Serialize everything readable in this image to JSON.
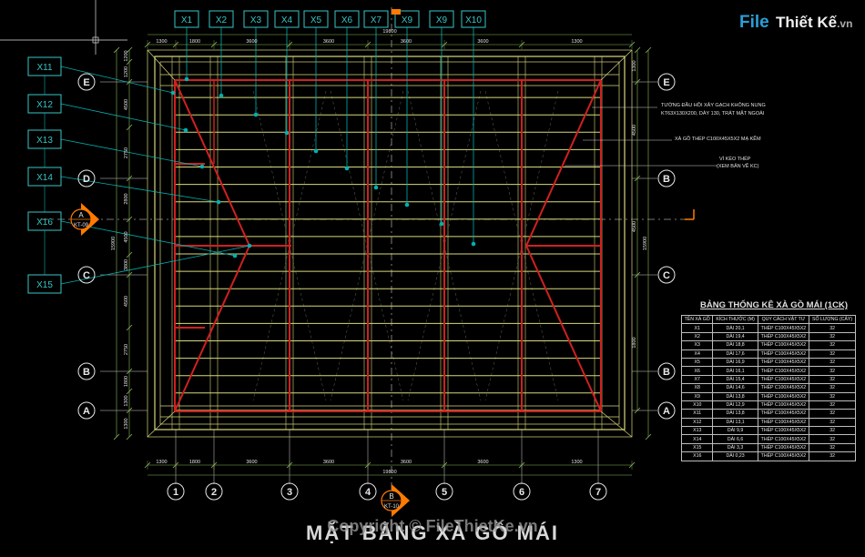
{
  "drawing_title": "MẶT BẰNG XÀ GỒ MÁI",
  "watermark": {
    "brand_blue": "File",
    "brand_rest": "Thiết Kế",
    "brand_tld": ".vn",
    "copyright": "Copyright © FileThietKe.vn"
  },
  "purlin_tags_top": [
    "X1",
    "X2",
    "X3",
    "X4",
    "X5",
    "X6",
    "X7",
    "X9",
    "X9",
    "X10"
  ],
  "purlin_tags_left": [
    "X11",
    "X12",
    "X13",
    "X14",
    "X16",
    "X15"
  ],
  "grid_numbers": [
    "1",
    "2",
    "3",
    "4",
    "5",
    "6",
    "7"
  ],
  "grid_letters_left": [
    "E",
    "D",
    "C",
    "B",
    "A"
  ],
  "grid_letters_right": [
    "E",
    "B",
    "C",
    "B",
    "A"
  ],
  "dimensions": {
    "top_segments": [
      "1300",
      "1800",
      "3600",
      "3600",
      "3600",
      "3600",
      "1300"
    ],
    "top_total": "19800",
    "bottom_segments": [
      "1300",
      "1800",
      "3600",
      "3600",
      "3600",
      "3600",
      "1300"
    ],
    "bottom_total": "19800",
    "left_segments": [
      "1200",
      "1200",
      "4500",
      "2750",
      "2800",
      "4500",
      "3800",
      "4500",
      "2750",
      "1800",
      "1300",
      "1300"
    ],
    "left_total": "15900",
    "right_segments": [
      "1300",
      "4500",
      "4500",
      "1800"
    ],
    "right_total": "15900"
  },
  "section_markers": [
    {
      "letter": "A",
      "sheet": "KT-09"
    },
    {
      "letter": "B",
      "sheet": "KT-10"
    }
  ],
  "notes": [
    "TƯỜNG ĐẦU HỒI XÂY GẠCH KHÔNG NUNG",
    "KT63X130X200, DÀY 130, TRÁT MẶT NGOÀI",
    "XÀ GỒ THÉP C100X45X5X2 MẠ KẼM",
    "VÌ KÈO THÉP",
    "(XEM BẢN VẼ KC)"
  ],
  "table": {
    "title": "BẢNG THỐNG KÊ XÀ GỒ MÁI (1CK)",
    "headers": [
      "TÊN XÀ GỒ",
      "KÍCH THƯỚC (M)",
      "QUY CÁCH VẬT TƯ",
      "SỐ LƯỢNG (CÂY)"
    ],
    "rows": [
      [
        "X1",
        "DÀI 20,1",
        "THÉP C100X45X5X2",
        "32"
      ],
      [
        "X2",
        "DÀI 19,4",
        "THÉP C100X45X5X2",
        "32"
      ],
      [
        "X3",
        "DÀI 18,8",
        "THÉP C100X45X5X2",
        "32"
      ],
      [
        "X4",
        "DÀI 17,6",
        "THÉP C100X45X5X2",
        "32"
      ],
      [
        "X5",
        "DÀI 16,9",
        "THÉP C100X45X5X2",
        "32"
      ],
      [
        "X6",
        "DÀI 16,1",
        "THÉP C100X45X5X2",
        "32"
      ],
      [
        "X7",
        "DÀI 15,4",
        "THÉP C100X45X5X2",
        "32"
      ],
      [
        "X8",
        "DÀI 14,6",
        "THÉP C100X45X5X2",
        "32"
      ],
      [
        "X9",
        "DÀI 13,8",
        "THÉP C100X45X5X2",
        "32"
      ],
      [
        "X10",
        "DÀI 12,9",
        "THÉP C100X45X5X2",
        "32"
      ],
      [
        "X11",
        "DÀI 13,8",
        "THÉP C100X45X5X2",
        "32"
      ],
      [
        "X12",
        "DÀI 13,1",
        "THÉP C100X45X5X2",
        "32"
      ],
      [
        "X13",
        "DÀI 9,9",
        "THÉP C100X45X5X2",
        "32"
      ],
      [
        "X14",
        "DÀI 6,6",
        "THÉP C100X45X5X2",
        "32"
      ],
      [
        "X15",
        "DÀI 3,3",
        "THÉP C100X45X5X2",
        "32"
      ],
      [
        "X16",
        "DÀI 0,23",
        "THÉP C100X45X5X2",
        "32"
      ]
    ]
  },
  "colors": {
    "background": "#000000",
    "rafter_red": "#d02020",
    "purlin_yellow": "#d8d87a",
    "grid_white": "#e8e8e8",
    "leader_cyan": "#00b0b0",
    "tag_cyan": "#37c6c6",
    "section_orange": "#ff7a00",
    "dimension_green": "#8ab85a",
    "axis_dash": "#9a9a9a"
  }
}
